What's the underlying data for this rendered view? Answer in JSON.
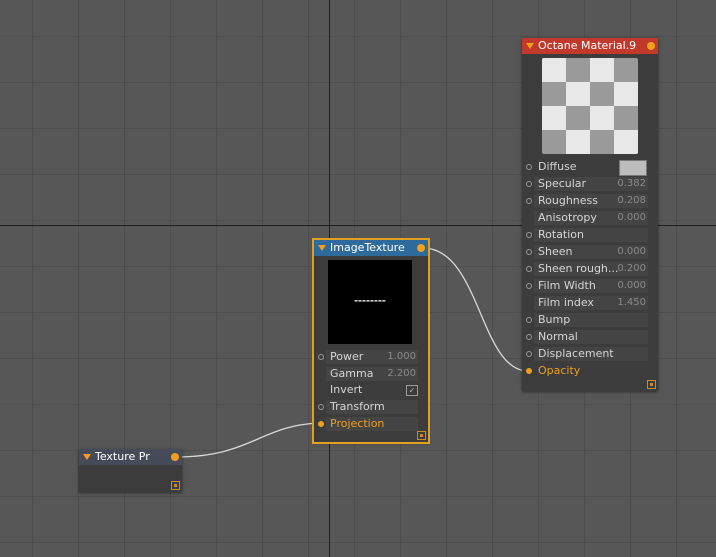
{
  "material_node": {
    "title": "Octane Material.9",
    "inputs": [
      {
        "label": "Diffuse",
        "value": ""
      },
      {
        "label": "Specular",
        "value": "0.382"
      },
      {
        "label": "Roughness",
        "value": "0.208"
      },
      {
        "label": "Anisotropy",
        "value": "0.000"
      },
      {
        "label": "Rotation",
        "value": ""
      },
      {
        "label": "Sheen",
        "value": "0.000"
      },
      {
        "label": "Sheen rough...",
        "value": "0.200"
      },
      {
        "label": "Film Width",
        "value": "0.000"
      },
      {
        "label": "Film index",
        "value": "1.450"
      },
      {
        "label": "Bump",
        "value": ""
      },
      {
        "label": "Normal",
        "value": ""
      },
      {
        "label": "Displacement",
        "value": ""
      },
      {
        "label": "Opacity",
        "value": ""
      }
    ]
  },
  "image_texture_node": {
    "title": "ImageTexture",
    "inputs": [
      {
        "label": "Power",
        "value": "1.000"
      },
      {
        "label": "Gamma",
        "value": "2.200"
      },
      {
        "label": "Invert",
        "value": ""
      },
      {
        "label": "Transform",
        "value": ""
      },
      {
        "label": "Projection",
        "value": ""
      }
    ],
    "invert_checked": true
  },
  "projection_node": {
    "title": "Texture Pr"
  },
  "colors": {
    "material_header": "#c0392b",
    "texture_header": "#2f6a9c",
    "projection_header": "#464b5a",
    "port_active": "#f0a01c",
    "selection_outline": "#e0a020"
  }
}
